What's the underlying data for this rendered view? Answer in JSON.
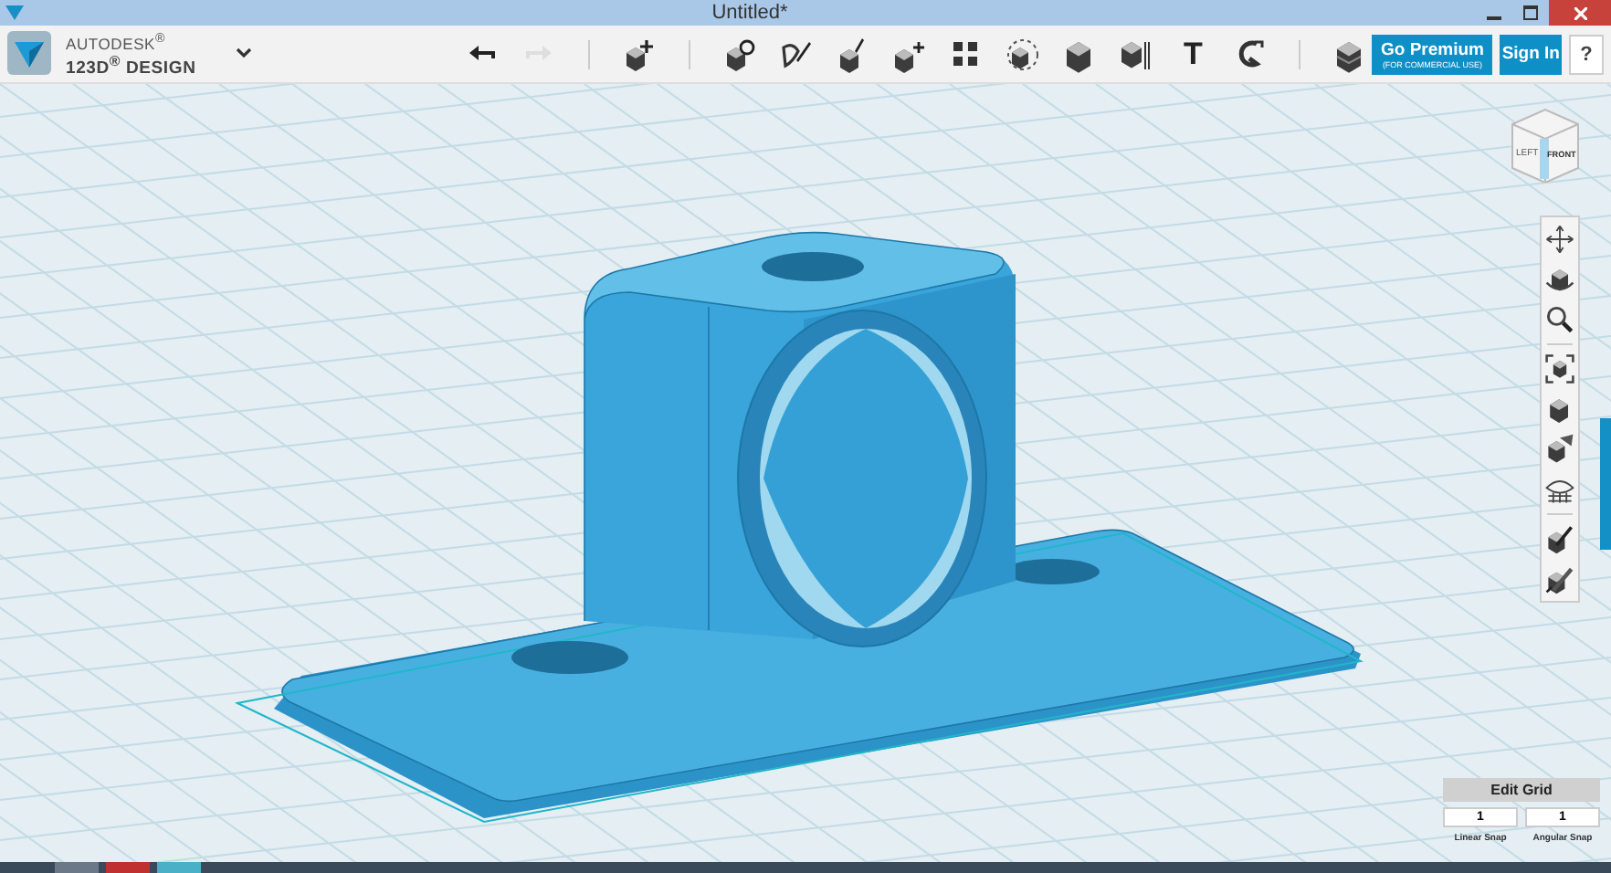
{
  "window": {
    "title": "Untitled*"
  },
  "brand": {
    "line_1": "AUTODESK$^{®}$",
    "line_2": "123D$^{®}$ DESIGN"
  },
  "toolbar_groups": [
    [
      {
        "kind": "undo",
        "disabled": false
      },
      {
        "kind": "redo",
        "disabled": true
      }
    ],
    [
      {
        "kind": "primitive",
        "disabled": false
      }
    ],
    [
      {
        "kind": "sketch",
        "disabled": false
      },
      {
        "kind": "construct",
        "disabled": false
      },
      {
        "kind": "modify",
        "disabled": false
      },
      {
        "kind": "pattern",
        "disabled": false
      },
      {
        "kind": "grouping",
        "disabled": false
      },
      {
        "kind": "combine",
        "disabled": false
      },
      {
        "kind": "measure",
        "disabled": false
      },
      {
        "kind": "solid",
        "disabled": false
      },
      {
        "kind": "text",
        "glyph": "T",
        "disabled": false
      },
      {
        "kind": "snap",
        "disabled": false
      }
    ],
    [
      {
        "kind": "material",
        "disabled": false
      }
    ]
  ],
  "premium": {
    "label": "Go Premium",
    "sublabel": "(FOR COMMERCIAL USE)"
  },
  "sign_in": "Sign In",
  "help": "?",
  "view_cube": {
    "left": "LEFT",
    "front": "FRONT"
  },
  "nav_groups": [
    [
      {
        "kind": "pan"
      },
      {
        "kind": "orbit"
      },
      {
        "kind": "zoom"
      }
    ],
    [
      {
        "kind": "fit"
      },
      {
        "kind": "view"
      },
      {
        "kind": "shading"
      },
      {
        "kind": "visibility"
      }
    ],
    [
      {
        "kind": "edit_a"
      },
      {
        "kind": "edit_b"
      }
    ]
  ],
  "grid": {
    "button": "Edit Grid",
    "linear_snap": {
      "value": "1",
      "label": "Linear Snap"
    },
    "angular_snap": {
      "value": "1",
      "label": "Angular Snap"
    }
  }
}
